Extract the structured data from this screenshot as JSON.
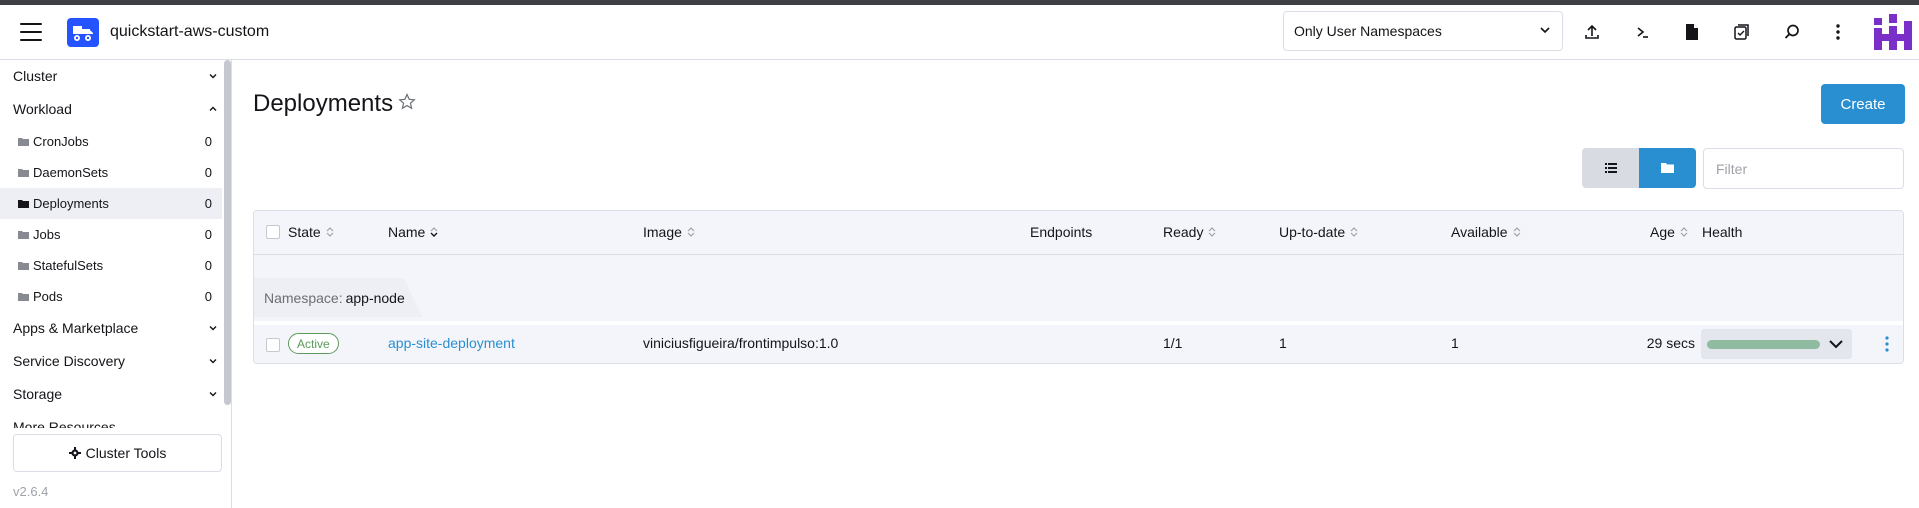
{
  "header": {
    "cluster_name": "quickstart-aws-custom",
    "namespace_filter": "Only User Namespaces",
    "icons": [
      "upload-icon",
      "kubectl-shell-icon",
      "kubeconfig-file-icon",
      "copy-kubeconfig-icon",
      "search-icon",
      "more-options-icon"
    ]
  },
  "sidebar": {
    "groups": {
      "cluster": "Cluster",
      "workload": "Workload",
      "apps": "Apps & Marketplace",
      "service_discovery": "Service Discovery",
      "storage": "Storage",
      "more": "More Resources"
    },
    "workload_items": [
      {
        "label": "CronJobs",
        "count": "0"
      },
      {
        "label": "DaemonSets",
        "count": "0"
      },
      {
        "label": "Deployments",
        "count": "0"
      },
      {
        "label": "Jobs",
        "count": "0"
      },
      {
        "label": "StatefulSets",
        "count": "0"
      },
      {
        "label": "Pods",
        "count": "0"
      }
    ],
    "cluster_tools": "Cluster Tools",
    "version": "v2.6.4"
  },
  "main": {
    "title": "Deployments",
    "create_label": "Create",
    "filter_placeholder": "Filter",
    "columns": {
      "state": "State",
      "name": "Name",
      "image": "Image",
      "endpoints": "Endpoints",
      "ready": "Ready",
      "uptodate": "Up-to-date",
      "available": "Available",
      "age": "Age",
      "health": "Health"
    },
    "group": {
      "prefix": "Namespace:",
      "name": "app-node"
    },
    "rows": [
      {
        "state": "Active",
        "name": "app-site-deployment",
        "image": "viniciusfigueira/frontimpulso:1.0",
        "endpoints": "",
        "ready": "1/1",
        "uptodate": "1",
        "available": "1",
        "age": "29 secs",
        "health_ratio": 1.0
      }
    ]
  },
  "colors": {
    "accent": "#2a8fd1",
    "active": "#5d995d",
    "health": "#8fbca0",
    "logo": "#2453ff",
    "brand": "#7b2fc9"
  }
}
